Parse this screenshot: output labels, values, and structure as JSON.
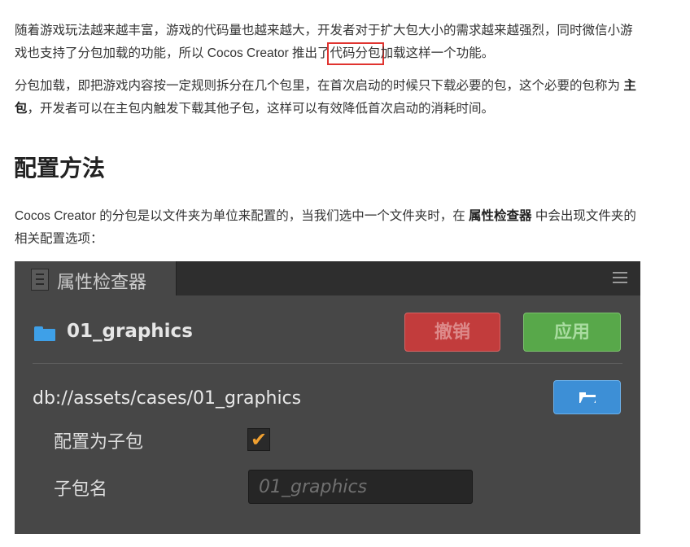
{
  "article": {
    "p1_a": "随着游戏玩法越来越丰富，游戏的代码量也越来越大，开发者对于扩大包大小的需求越来越强烈，同时微信小游戏也支持了分包加载的功能，所以 Cocos Creator 推出了",
    "p1_highlight": "代码分包",
    "p1_b": "加载这样一个功能。",
    "p2_a": "分包加载，即把游戏内容按一定规则拆分在几个包里，在首次启动的时候只下载必要的包，这个必要的包称为 ",
    "p2_bold": "主包",
    "p2_b": "，开发者可以在主包内触发下载其他子包，这样可以有效降低首次启动的消耗时间。",
    "heading": "配置方法",
    "p4_a": "Cocos Creator 的分包是以文件夹为单位来配置的，当我们选中一个文件夹时，在 ",
    "p4_bold": "属性检查器",
    "p4_b": " 中会出现文件夹的相关配置选项："
  },
  "inspector": {
    "tab_title": "属性检查器",
    "folder_name": "01_graphics",
    "revert_label": "撤销",
    "apply_label": "应用",
    "path": "db://assets/cases/01_graphics",
    "subpackage_label": "配置为子包",
    "subpackage_checked": true,
    "checkmark": "✔",
    "name_label": "子包名",
    "name_placeholder": "01_graphics"
  },
  "colors": {
    "highlight_box": "#e0332f",
    "revert_button": "#c23c3c",
    "apply_button": "#58a84a",
    "browse_button": "#3d8fd6",
    "folder_icon": "#3ea0e8",
    "checkmark": "#f0a030"
  },
  "icons": [
    "inspector-icon",
    "menu-icon",
    "folder-icon",
    "folder-open-icon",
    "checkmark-icon"
  ]
}
